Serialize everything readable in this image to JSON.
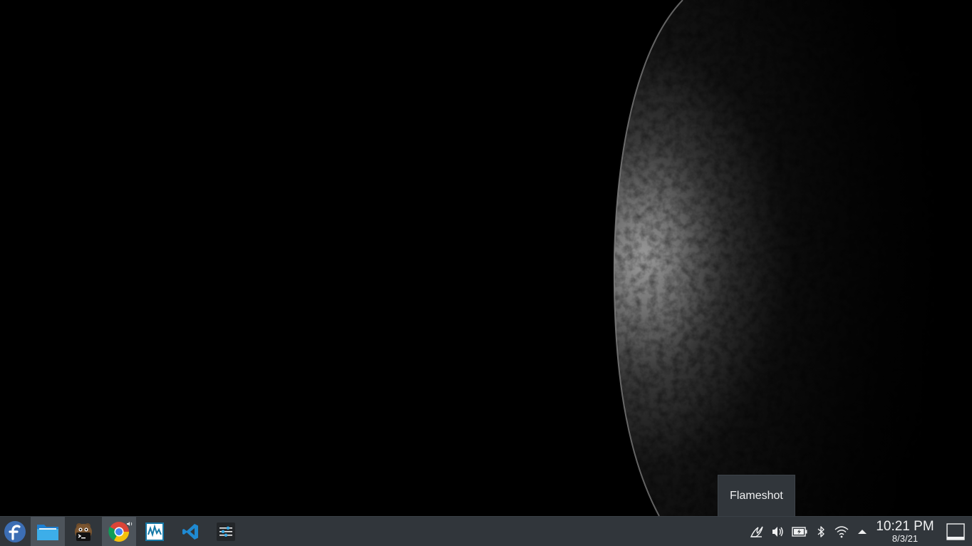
{
  "tooltip": {
    "text": "Flameshot"
  },
  "taskbar": {
    "launcher": {
      "icon": "fedora-icon"
    },
    "tasks": [
      {
        "name": "file-manager",
        "icon": "folder-icon",
        "active": true
      },
      {
        "name": "terminal",
        "icon": "terminal-icon",
        "active": false
      },
      {
        "name": "chrome",
        "icon": "chrome-icon",
        "active": true,
        "audio_playing": true
      },
      {
        "name": "wireshark",
        "icon": "wireshark-icon",
        "active": false
      },
      {
        "name": "vscode",
        "icon": "vscode-icon",
        "active": false
      },
      {
        "name": "settings",
        "icon": "settings-sliders-icon",
        "active": false
      }
    ],
    "tray": [
      {
        "name": "flameshot",
        "icon": "flameshot-icon"
      },
      {
        "name": "volume",
        "icon": "speaker-icon"
      },
      {
        "name": "battery",
        "icon": "battery-icon"
      },
      {
        "name": "bluetooth",
        "icon": "bluetooth-icon"
      },
      {
        "name": "wifi",
        "icon": "wifi-icon"
      },
      {
        "name": "expand",
        "icon": "chevron-up-icon"
      }
    ],
    "clock": {
      "time": "10:21 PM",
      "date": "8/3/21"
    },
    "show_desktop": {
      "icon": "show-desktop-icon"
    }
  },
  "colors": {
    "panel": "#31363b",
    "panel_active": "#4d545b",
    "text": "#eff0f1",
    "accent_blue": "#3daee9"
  }
}
